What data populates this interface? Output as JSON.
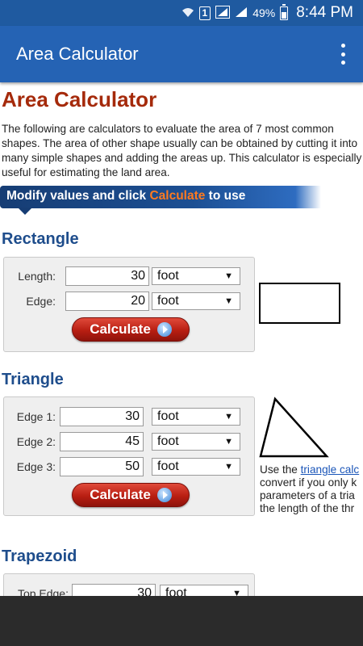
{
  "status_bar": {
    "sim_label": "1",
    "battery_text": "49%",
    "battery_level": 0.49,
    "time": "8:44 PM"
  },
  "app_bar": {
    "title": "Area Calculator"
  },
  "page": {
    "title": "Area Calculator",
    "intro": "The following are calculators to evaluate the area of 7 most common shapes. The area of other shape usually can be obtained by cutting it into many simple shapes and adding the areas up. This calculator is especially useful for estimating the land area.",
    "banner_prefix": "Modify values and click ",
    "banner_highlight": "Calculate",
    "banner_suffix": " to use"
  },
  "rectangle": {
    "title": "Rectangle",
    "length_label": "Length:",
    "length_value": "30",
    "length_unit": "foot",
    "edge_label": "Edge:",
    "edge_value": "20",
    "edge_unit": "foot",
    "button": "Calculate"
  },
  "triangle": {
    "title": "Triangle",
    "edge1_label": "Edge 1:",
    "edge1_value": "30",
    "edge1_unit": "foot",
    "edge2_label": "Edge 2:",
    "edge2_value": "45",
    "edge2_unit": "foot",
    "edge3_label": "Edge 3:",
    "edge3_value": "50",
    "edge3_unit": "foot",
    "button": "Calculate",
    "note_prefix": "Use the ",
    "note_link": "triangle calc",
    "note_line2": "convert if you only k",
    "note_line3": "parameters of a tria",
    "note_line4": "the length of the thr"
  },
  "trapezoid": {
    "title": "Trapezoid",
    "top_edge_label": "Top Edge:",
    "top_edge_value": "30",
    "top_edge_unit": "foot"
  },
  "colors": {
    "status_bar": "#1f5aa0",
    "app_bar": "#2563b4",
    "page_title": "#a52a0b",
    "section_title": "#1e4d8c",
    "button": "#b81e12"
  }
}
